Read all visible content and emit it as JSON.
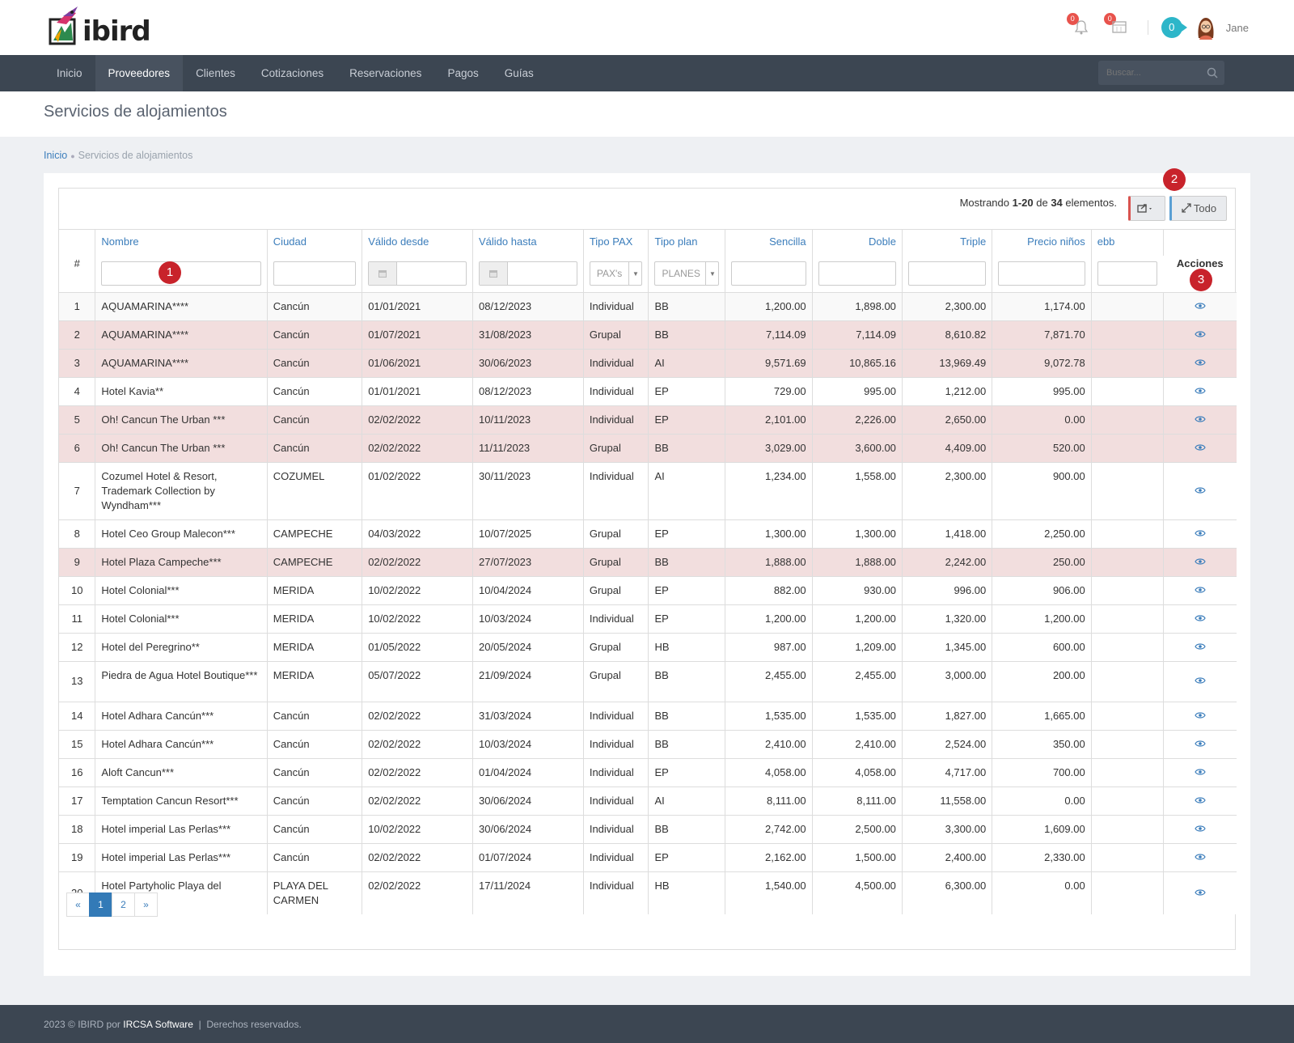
{
  "brand": {
    "name": "ibird"
  },
  "header": {
    "notifications_count": "0",
    "calendar_count": "0",
    "counter": "0",
    "user_name": "Jane"
  },
  "nav": {
    "items": [
      "Inicio",
      "Proveedores",
      "Clientes",
      "Cotizaciones",
      "Reservaciones",
      "Pagos",
      "Guías"
    ],
    "active": "Proveedores",
    "search_placeholder": "Buscar..."
  },
  "page": {
    "title": "Servicios de alojamientos",
    "breadcrumb": {
      "home": "Inicio",
      "current": "Servicios de alojamientos"
    }
  },
  "grid": {
    "summary_prefix": "Mostrando ",
    "summary_range": "1-20",
    "summary_mid": " de ",
    "summary_total": "34",
    "summary_suffix": " elementos.",
    "all_button": "Todo",
    "columns": {
      "num": "#",
      "nombre": "Nombre",
      "ciudad": "Ciudad",
      "valido_desde": "Válido desde",
      "valido_hasta": "Válido hasta",
      "tipo_pax": "Tipo PAX",
      "tipo_plan": "Tipo plan",
      "sencilla": "Sencilla",
      "doble": "Doble",
      "triple": "Triple",
      "precio_ninos": "Precio niños",
      "ebb": "ebb",
      "acciones": "Acciones"
    },
    "filters": {
      "pax_placeholder": "PAX's",
      "plan_placeholder": "PLANES"
    },
    "rows": [
      {
        "n": "1",
        "nombre": "AQUAMARINA****",
        "ciudad": "Cancún",
        "desde": "01/01/2021",
        "hasta": "08/12/2023",
        "pax": "Individual",
        "plan": "BB",
        "sencilla": "1,200.00",
        "doble": "1,898.00",
        "triple": "2,300.00",
        "ninos": "1,174.00",
        "ebb": "",
        "hl": false
      },
      {
        "n": "2",
        "nombre": "AQUAMARINA****",
        "ciudad": "Cancún",
        "desde": "01/07/2021",
        "hasta": "31/08/2023",
        "pax": "Grupal",
        "plan": "BB",
        "sencilla": "7,114.09",
        "doble": "7,114.09",
        "triple": "8,610.82",
        "ninos": "7,871.70",
        "ebb": "",
        "hl": true
      },
      {
        "n": "3",
        "nombre": "AQUAMARINA****",
        "ciudad": "Cancún",
        "desde": "01/06/2021",
        "hasta": "30/06/2023",
        "pax": "Individual",
        "plan": "AI",
        "sencilla": "9,571.69",
        "doble": "10,865.16",
        "triple": "13,969.49",
        "ninos": "9,072.78",
        "ebb": "",
        "hl": true
      },
      {
        "n": "4",
        "nombre": "Hotel Kavia**",
        "ciudad": "Cancún",
        "desde": "01/01/2021",
        "hasta": "08/12/2023",
        "pax": "Individual",
        "plan": "EP",
        "sencilla": "729.00",
        "doble": "995.00",
        "triple": "1,212.00",
        "ninos": "995.00",
        "ebb": "",
        "hl": false
      },
      {
        "n": "5",
        "nombre": "Oh! Cancun The Urban ***",
        "ciudad": "Cancún",
        "desde": "02/02/2022",
        "hasta": "10/11/2023",
        "pax": "Individual",
        "plan": "EP",
        "sencilla": "2,101.00",
        "doble": "2,226.00",
        "triple": "2,650.00",
        "ninos": "0.00",
        "ebb": "",
        "hl": true
      },
      {
        "n": "6",
        "nombre": "Oh! Cancun The Urban ***",
        "ciudad": "Cancún",
        "desde": "02/02/2022",
        "hasta": "11/11/2023",
        "pax": "Grupal",
        "plan": "BB",
        "sencilla": "3,029.00",
        "doble": "3,600.00",
        "triple": "4,409.00",
        "ninos": "520.00",
        "ebb": "",
        "hl": true
      },
      {
        "n": "7",
        "nombre": "Cozumel Hotel & Resort, Trademark Collection by Wyndham***",
        "ciudad": "COZUMEL",
        "desde": "01/02/2022",
        "hasta": "30/11/2023",
        "pax": "Individual",
        "plan": "AI",
        "sencilla": "1,234.00",
        "doble": "1,558.00",
        "triple": "2,300.00",
        "ninos": "900.00",
        "ebb": "",
        "hl": false
      },
      {
        "n": "8",
        "nombre": "Hotel Ceo Group Malecon***",
        "ciudad": "CAMPECHE",
        "desde": "04/03/2022",
        "hasta": "10/07/2025",
        "pax": "Grupal",
        "plan": "EP",
        "sencilla": "1,300.00",
        "doble": "1,300.00",
        "triple": "1,418.00",
        "ninos": "2,250.00",
        "ebb": "",
        "hl": false
      },
      {
        "n": "9",
        "nombre": "Hotel Plaza Campeche***",
        "ciudad": "CAMPECHE",
        "desde": "02/02/2022",
        "hasta": "27/07/2023",
        "pax": "Grupal",
        "plan": "BB",
        "sencilla": "1,888.00",
        "doble": "1,888.00",
        "triple": "2,242.00",
        "ninos": "250.00",
        "ebb": "",
        "hl": true
      },
      {
        "n": "10",
        "nombre": "Hotel Colonial***",
        "ciudad": "MERIDA",
        "desde": "10/02/2022",
        "hasta": "10/04/2024",
        "pax": "Grupal",
        "plan": "EP",
        "sencilla": "882.00",
        "doble": "930.00",
        "triple": "996.00",
        "ninos": "906.00",
        "ebb": "",
        "hl": false
      },
      {
        "n": "11",
        "nombre": "Hotel Colonial***",
        "ciudad": "MERIDA",
        "desde": "10/02/2022",
        "hasta": "10/03/2024",
        "pax": "Individual",
        "plan": "EP",
        "sencilla": "1,200.00",
        "doble": "1,200.00",
        "triple": "1,320.00",
        "ninos": "1,200.00",
        "ebb": "",
        "hl": false
      },
      {
        "n": "12",
        "nombre": "Hotel del Peregrino**",
        "ciudad": "MERIDA",
        "desde": "01/05/2022",
        "hasta": "20/05/2024",
        "pax": "Grupal",
        "plan": "HB",
        "sencilla": "987.00",
        "doble": "1,209.00",
        "triple": "1,345.00",
        "ninos": "600.00",
        "ebb": "",
        "hl": false
      },
      {
        "n": "13",
        "nombre": "Piedra de Agua Hotel Boutique***",
        "ciudad": "MERIDA",
        "desde": "05/07/2022",
        "hasta": "21/09/2024",
        "pax": "Grupal",
        "plan": "BB",
        "sencilla": "2,455.00",
        "doble": "2,455.00",
        "triple": "3,000.00",
        "ninos": "200.00",
        "ebb": "",
        "hl": false
      },
      {
        "n": "14",
        "nombre": "Hotel Adhara Cancún***",
        "ciudad": "Cancún",
        "desde": "02/02/2022",
        "hasta": "31/03/2024",
        "pax": "Individual",
        "plan": "BB",
        "sencilla": "1,535.00",
        "doble": "1,535.00",
        "triple": "1,827.00",
        "ninos": "1,665.00",
        "ebb": "",
        "hl": false
      },
      {
        "n": "15",
        "nombre": "Hotel Adhara Cancún***",
        "ciudad": "Cancún",
        "desde": "02/02/2022",
        "hasta": "10/03/2024",
        "pax": "Individual",
        "plan": "BB",
        "sencilla": "2,410.00",
        "doble": "2,410.00",
        "triple": "2,524.00",
        "ninos": "350.00",
        "ebb": "",
        "hl": false
      },
      {
        "n": "16",
        "nombre": "Aloft Cancun***",
        "ciudad": "Cancún",
        "desde": "02/02/2022",
        "hasta": "01/04/2024",
        "pax": "Individual",
        "plan": "EP",
        "sencilla": "4,058.00",
        "doble": "4,058.00",
        "triple": "4,717.00",
        "ninos": "700.00",
        "ebb": "",
        "hl": false
      },
      {
        "n": "17",
        "nombre": "Temptation Cancun Resort***",
        "ciudad": "Cancún",
        "desde": "02/02/2022",
        "hasta": "30/06/2024",
        "pax": "Individual",
        "plan": "AI",
        "sencilla": "8,111.00",
        "doble": "8,111.00",
        "triple": "11,558.00",
        "ninos": "0.00",
        "ebb": "",
        "hl": false
      },
      {
        "n": "18",
        "nombre": "Hotel imperial Las Perlas***",
        "ciudad": "Cancún",
        "desde": "10/02/2022",
        "hasta": "30/06/2024",
        "pax": "Individual",
        "plan": "BB",
        "sencilla": "2,742.00",
        "doble": "2,500.00",
        "triple": "3,300.00",
        "ninos": "1,609.00",
        "ebb": "",
        "hl": false
      },
      {
        "n": "19",
        "nombre": "Hotel imperial Las Perlas***",
        "ciudad": "Cancún",
        "desde": "02/02/2022",
        "hasta": "01/07/2024",
        "pax": "Individual",
        "plan": "EP",
        "sencilla": "2,162.00",
        "doble": "1,500.00",
        "triple": "2,400.00",
        "ninos": "2,330.00",
        "ebb": "",
        "hl": false
      },
      {
        "n": "20",
        "nombre": "Hotel Partyholic Playa del Carmen***",
        "ciudad": "PLAYA DEL CARMEN",
        "desde": "02/02/2022",
        "hasta": "17/11/2024",
        "pax": "Individual",
        "plan": "HB",
        "sencilla": "1,540.00",
        "doble": "4,500.00",
        "triple": "6,300.00",
        "ninos": "0.00",
        "ebb": "",
        "hl": false
      }
    ],
    "pagination": {
      "prev": "«",
      "pages": [
        "1",
        "2"
      ],
      "current": "1",
      "next": "»"
    }
  },
  "annotations": [
    "1",
    "2",
    "3"
  ],
  "footer": {
    "prefix": "2023 © IBIRD por ",
    "company": "IRCSA Software",
    "suffix": "  |  Derechos reservados."
  },
  "colors": {
    "nav_bg": "#3c4652",
    "link": "#3b7dbb",
    "row_highlight": "#f2dede",
    "badge_red": "#c8232b",
    "counter": "#2db6c9"
  },
  "icons": [
    "bell-icon",
    "calendar-icon",
    "search-icon",
    "share-icon",
    "expand-icon",
    "eye-icon",
    "date-icon"
  ]
}
